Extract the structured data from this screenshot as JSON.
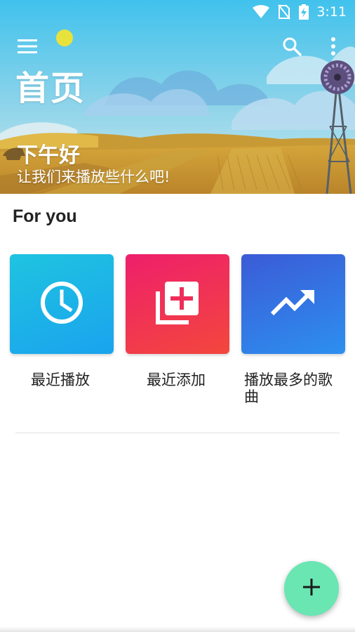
{
  "status_bar": {
    "time": "3:11",
    "icons": [
      "wifi-icon",
      "no-sim-icon",
      "battery-charging-icon"
    ]
  },
  "toolbar": {
    "title": "首页",
    "menu_icon": "menu-icon",
    "search_icon": "search-icon",
    "more_icon": "more-vert-icon"
  },
  "header": {
    "greeting": "下午好",
    "subtitle": "让我们来播放些什么吧!"
  },
  "section": {
    "title": "For you"
  },
  "cards": [
    {
      "label": "最近播放",
      "icon": "clock-icon",
      "colors": [
        "#1fc4e0",
        "#1aa3ee"
      ]
    },
    {
      "label": "最近添加",
      "icon": "playlist-add-icon",
      "colors": [
        "#ee1f6b",
        "#f3473d"
      ]
    },
    {
      "label": "播放最多的歌曲",
      "icon": "trending-up-icon",
      "colors": [
        "#3b5bd6",
        "#2d8ff0"
      ]
    }
  ],
  "fab": {
    "icon": "plus-icon",
    "color": "#69e6b2"
  }
}
